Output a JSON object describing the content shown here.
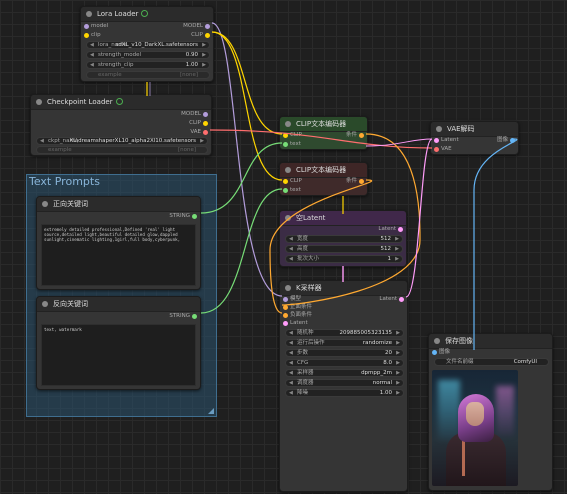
{
  "group": {
    "title": "Text Prompts"
  },
  "lora": {
    "title": "Lora Loader",
    "inputs": [
      "model",
      "clip"
    ],
    "outputs": [
      "MODEL",
      "CLIP"
    ],
    "widgets": [
      {
        "label": "lora_name",
        "value": "sdXL_v10_DarkXL.safetensors"
      },
      {
        "label": "strength_model",
        "value": "0.90"
      },
      {
        "label": "strength_clip",
        "value": "1.00"
      }
    ],
    "example": {
      "label": "example",
      "value": "[none]"
    }
  },
  "checkpoint": {
    "title": "Checkpoint Loader",
    "outputs": [
      "MODEL",
      "CLIP",
      "VAE"
    ],
    "widgets": [
      {
        "label": "ckpt_name",
        "value": "XL\\dreamshaperXL10_alpha2Xl10.safetensors"
      }
    ],
    "example": {
      "label": "example",
      "value": "[none]"
    }
  },
  "positive_prompt": {
    "title": "正向关键词",
    "output": "STRING",
    "text": "extremely detailed professional,Defined 'real' light source,detailed light,beautiful detailed glow,dappled sunlight,cinematic lighting,1girl,full body,cyberpunk,"
  },
  "negative_prompt": {
    "title": "反向关键词",
    "output": "STRING",
    "text": "text, watermark"
  },
  "clip_pos": {
    "title": "CLIP文本编码器",
    "inputs": [
      "CLIP",
      "text"
    ],
    "output": "条件"
  },
  "clip_neg": {
    "title": "CLIP文本编码器",
    "inputs": [
      "CLIP",
      "text"
    ],
    "output": "条件"
  },
  "latent": {
    "title": "空Latent",
    "output": "Latent",
    "widgets": [
      {
        "label": "宽度",
        "value": "512"
      },
      {
        "label": "高度",
        "value": "512"
      },
      {
        "label": "批次大小",
        "value": "1"
      }
    ]
  },
  "ksampler": {
    "title": "K采样器",
    "inputs": [
      "模型",
      "正面条件",
      "负面条件",
      "Latent"
    ],
    "output": "Latent",
    "widgets": [
      {
        "label": "随机种",
        "value": "209885005323135"
      },
      {
        "label": "运行后操作",
        "value": "randomize"
      },
      {
        "label": "步数",
        "value": "20"
      },
      {
        "label": "CFG",
        "value": "8.0"
      },
      {
        "label": "采样器",
        "value": "dpmpp_2m"
      },
      {
        "label": "调度器",
        "value": "normal"
      },
      {
        "label": "降噪",
        "value": "1.00"
      }
    ]
  },
  "vae": {
    "title": "VAE解码",
    "inputs": [
      "Latent",
      "VAE"
    ],
    "output": "图像"
  },
  "save": {
    "title": "保存图像",
    "input": "图像",
    "widget": {
      "label": "文件名前缀",
      "value": "ComfyUI"
    }
  },
  "colors": {
    "model": "#b39ddb",
    "clip": "#ffd500",
    "vae": "#ff6e6e",
    "cond_pos": "#ffa931",
    "cond_neg": "#ffa931",
    "latent": "#ff9cf9",
    "image": "#64b5f6",
    "string": "#77dd77"
  }
}
